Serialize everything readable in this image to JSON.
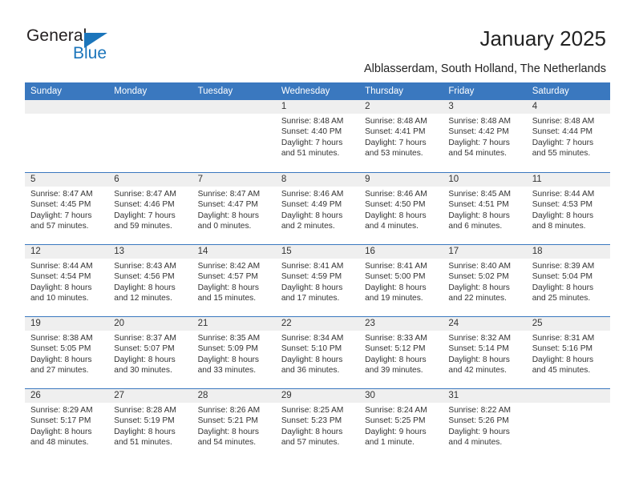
{
  "brand": {
    "name_part1": "General",
    "name_part2": "Blue",
    "triangle_color": "#1b75bb"
  },
  "header": {
    "title": "January 2025",
    "subtitle": "Alblasserdam, South Holland, The Netherlands"
  },
  "theme": {
    "header_blue": "#3a78bf",
    "day_band_gray": "#efefef",
    "text_color": "#333333"
  },
  "calendar": {
    "weekdays": [
      "Sunday",
      "Monday",
      "Tuesday",
      "Wednesday",
      "Thursday",
      "Friday",
      "Saturday"
    ],
    "weeks": [
      [
        {
          "day": "",
          "empty": true
        },
        {
          "day": "",
          "empty": true
        },
        {
          "day": "",
          "empty": true
        },
        {
          "day": "1",
          "sunrise": "Sunrise: 8:48 AM",
          "sunset": "Sunset: 4:40 PM",
          "daylight": "Daylight: 7 hours and 51 minutes."
        },
        {
          "day": "2",
          "sunrise": "Sunrise: 8:48 AM",
          "sunset": "Sunset: 4:41 PM",
          "daylight": "Daylight: 7 hours and 53 minutes."
        },
        {
          "day": "3",
          "sunrise": "Sunrise: 8:48 AM",
          "sunset": "Sunset: 4:42 PM",
          "daylight": "Daylight: 7 hours and 54 minutes."
        },
        {
          "day": "4",
          "sunrise": "Sunrise: 8:48 AM",
          "sunset": "Sunset: 4:44 PM",
          "daylight": "Daylight: 7 hours and 55 minutes."
        }
      ],
      [
        {
          "day": "5",
          "sunrise": "Sunrise: 8:47 AM",
          "sunset": "Sunset: 4:45 PM",
          "daylight": "Daylight: 7 hours and 57 minutes."
        },
        {
          "day": "6",
          "sunrise": "Sunrise: 8:47 AM",
          "sunset": "Sunset: 4:46 PM",
          "daylight": "Daylight: 7 hours and 59 minutes."
        },
        {
          "day": "7",
          "sunrise": "Sunrise: 8:47 AM",
          "sunset": "Sunset: 4:47 PM",
          "daylight": "Daylight: 8 hours and 0 minutes."
        },
        {
          "day": "8",
          "sunrise": "Sunrise: 8:46 AM",
          "sunset": "Sunset: 4:49 PM",
          "daylight": "Daylight: 8 hours and 2 minutes."
        },
        {
          "day": "9",
          "sunrise": "Sunrise: 8:46 AM",
          "sunset": "Sunset: 4:50 PM",
          "daylight": "Daylight: 8 hours and 4 minutes."
        },
        {
          "day": "10",
          "sunrise": "Sunrise: 8:45 AM",
          "sunset": "Sunset: 4:51 PM",
          "daylight": "Daylight: 8 hours and 6 minutes."
        },
        {
          "day": "11",
          "sunrise": "Sunrise: 8:44 AM",
          "sunset": "Sunset: 4:53 PM",
          "daylight": "Daylight: 8 hours and 8 minutes."
        }
      ],
      [
        {
          "day": "12",
          "sunrise": "Sunrise: 8:44 AM",
          "sunset": "Sunset: 4:54 PM",
          "daylight": "Daylight: 8 hours and 10 minutes."
        },
        {
          "day": "13",
          "sunrise": "Sunrise: 8:43 AM",
          "sunset": "Sunset: 4:56 PM",
          "daylight": "Daylight: 8 hours and 12 minutes."
        },
        {
          "day": "14",
          "sunrise": "Sunrise: 8:42 AM",
          "sunset": "Sunset: 4:57 PM",
          "daylight": "Daylight: 8 hours and 15 minutes."
        },
        {
          "day": "15",
          "sunrise": "Sunrise: 8:41 AM",
          "sunset": "Sunset: 4:59 PM",
          "daylight": "Daylight: 8 hours and 17 minutes."
        },
        {
          "day": "16",
          "sunrise": "Sunrise: 8:41 AM",
          "sunset": "Sunset: 5:00 PM",
          "daylight": "Daylight: 8 hours and 19 minutes."
        },
        {
          "day": "17",
          "sunrise": "Sunrise: 8:40 AM",
          "sunset": "Sunset: 5:02 PM",
          "daylight": "Daylight: 8 hours and 22 minutes."
        },
        {
          "day": "18",
          "sunrise": "Sunrise: 8:39 AM",
          "sunset": "Sunset: 5:04 PM",
          "daylight": "Daylight: 8 hours and 25 minutes."
        }
      ],
      [
        {
          "day": "19",
          "sunrise": "Sunrise: 8:38 AM",
          "sunset": "Sunset: 5:05 PM",
          "daylight": "Daylight: 8 hours and 27 minutes."
        },
        {
          "day": "20",
          "sunrise": "Sunrise: 8:37 AM",
          "sunset": "Sunset: 5:07 PM",
          "daylight": "Daylight: 8 hours and 30 minutes."
        },
        {
          "day": "21",
          "sunrise": "Sunrise: 8:35 AM",
          "sunset": "Sunset: 5:09 PM",
          "daylight": "Daylight: 8 hours and 33 minutes."
        },
        {
          "day": "22",
          "sunrise": "Sunrise: 8:34 AM",
          "sunset": "Sunset: 5:10 PM",
          "daylight": "Daylight: 8 hours and 36 minutes."
        },
        {
          "day": "23",
          "sunrise": "Sunrise: 8:33 AM",
          "sunset": "Sunset: 5:12 PM",
          "daylight": "Daylight: 8 hours and 39 minutes."
        },
        {
          "day": "24",
          "sunrise": "Sunrise: 8:32 AM",
          "sunset": "Sunset: 5:14 PM",
          "daylight": "Daylight: 8 hours and 42 minutes."
        },
        {
          "day": "25",
          "sunrise": "Sunrise: 8:31 AM",
          "sunset": "Sunset: 5:16 PM",
          "daylight": "Daylight: 8 hours and 45 minutes."
        }
      ],
      [
        {
          "day": "26",
          "sunrise": "Sunrise: 8:29 AM",
          "sunset": "Sunset: 5:17 PM",
          "daylight": "Daylight: 8 hours and 48 minutes."
        },
        {
          "day": "27",
          "sunrise": "Sunrise: 8:28 AM",
          "sunset": "Sunset: 5:19 PM",
          "daylight": "Daylight: 8 hours and 51 minutes."
        },
        {
          "day": "28",
          "sunrise": "Sunrise: 8:26 AM",
          "sunset": "Sunset: 5:21 PM",
          "daylight": "Daylight: 8 hours and 54 minutes."
        },
        {
          "day": "29",
          "sunrise": "Sunrise: 8:25 AM",
          "sunset": "Sunset: 5:23 PM",
          "daylight": "Daylight: 8 hours and 57 minutes."
        },
        {
          "day": "30",
          "sunrise": "Sunrise: 8:24 AM",
          "sunset": "Sunset: 5:25 PM",
          "daylight": "Daylight: 9 hours and 1 minute."
        },
        {
          "day": "31",
          "sunrise": "Sunrise: 8:22 AM",
          "sunset": "Sunset: 5:26 PM",
          "daylight": "Daylight: 9 hours and 4 minutes."
        },
        {
          "day": "",
          "empty": true
        }
      ]
    ]
  }
}
